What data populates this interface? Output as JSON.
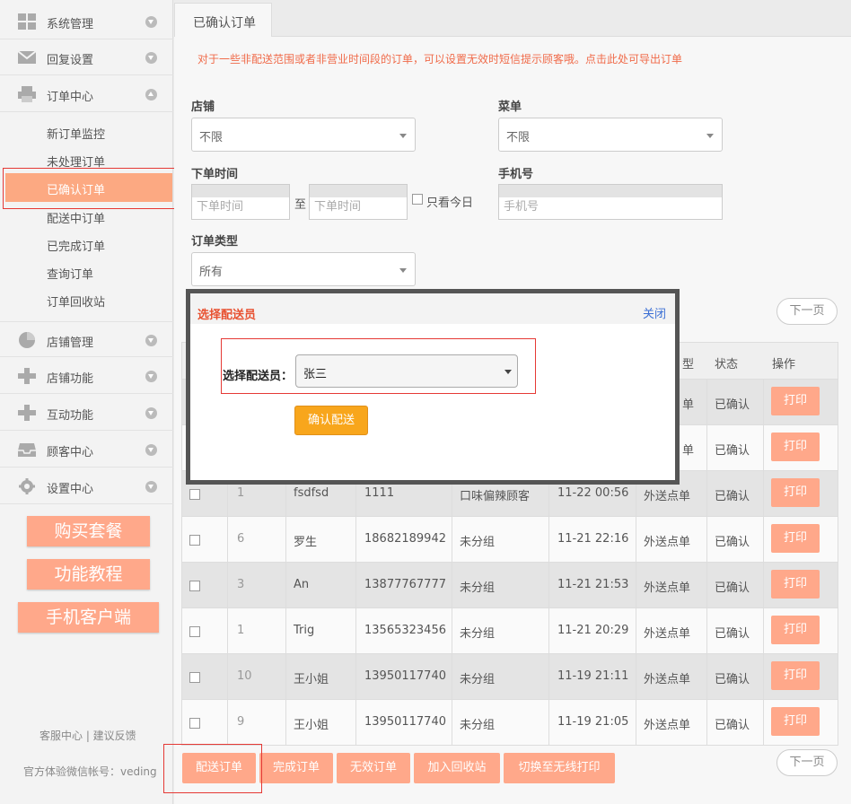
{
  "sidebar": {
    "items": [
      {
        "label": "系统管理",
        "icon": "grid-icon"
      },
      {
        "label": "回复设置",
        "icon": "envelope-icon"
      },
      {
        "label": "订单中心",
        "icon": "printer-icon"
      }
    ],
    "order_sub": [
      "新订单监控",
      "未处理订单",
      "已确认订单",
      "配送中订单",
      "已完成订单",
      "查询订单",
      "订单回收站"
    ],
    "items2": [
      {
        "label": "店铺管理",
        "icon": "pie-chart-icon"
      },
      {
        "label": "店铺功能",
        "icon": "plus-icon"
      },
      {
        "label": "互动功能",
        "icon": "plus-icon"
      },
      {
        "label": "顾客中心",
        "icon": "inbox-icon"
      },
      {
        "label": "设置中心",
        "icon": "gear-icon"
      }
    ],
    "promos": [
      "购买套餐",
      "功能教程",
      "手机客户端"
    ],
    "footer_links": "客服中心 | 建议反馈",
    "footer_account": "官方体验微信帐号：veding"
  },
  "tab": "已确认订单",
  "notice": "对于一些非配送范围或者非营业时间段的订单，可以设置无效时短信提示顾客哦。点击此处可导出订单",
  "filters": {
    "store_label": "店铺",
    "store_value": "不限",
    "menu_label": "菜单",
    "menu_value": "不限",
    "time_label": "下单时间",
    "time_from_ph": "下单时间",
    "time_to": "至",
    "time_to_ph": "下单时间",
    "today_label": "只看今日",
    "phone_label": "手机号",
    "phone_ph": "手机号",
    "type_label": "订单类型",
    "type_value": "所有"
  },
  "pager_next": "下一页",
  "table": {
    "headers": {
      "type_partial": "型",
      "status": "状态",
      "op": "操作"
    },
    "print_label": "打印",
    "rows": [
      {
        "num": "",
        "name": "",
        "phone": "",
        "group": "",
        "time": "",
        "type": "单",
        "status": "已确认"
      },
      {
        "num": "",
        "name": "",
        "phone": "",
        "group": "",
        "time": "",
        "type": "单",
        "status": "已确认"
      },
      {
        "num": "1",
        "name": "fsdfsd",
        "phone": "1111",
        "group": "口味偏辣顾客",
        "time": "11-22 00:56",
        "type": "外送点单",
        "status": "已确认"
      },
      {
        "num": "6",
        "name": "罗生",
        "phone": "18682189942",
        "group": "未分组",
        "time": "11-21 22:16",
        "type": "外送点单",
        "status": "已确认"
      },
      {
        "num": "3",
        "name": "An",
        "phone": "13877767777",
        "group": "未分组",
        "time": "11-21 21:53",
        "type": "外送点单",
        "status": "已确认"
      },
      {
        "num": "1",
        "name": "Trig",
        "phone": "13565323456",
        "group": "未分组",
        "time": "11-21 20:29",
        "type": "外送点单",
        "status": "已确认"
      },
      {
        "num": "10",
        "name": "王小姐",
        "phone": "13950117740",
        "group": "未分组",
        "time": "11-19 21:11",
        "type": "外送点单",
        "status": "已确认"
      },
      {
        "num": "9",
        "name": "王小姐",
        "phone": "13950117740",
        "group": "未分组",
        "time": "11-19 21:05",
        "type": "外送点单",
        "status": "已确认"
      }
    ]
  },
  "actions": [
    "配送订单",
    "完成订单",
    "无效订单",
    "加入回收站",
    "切换至无线打印"
  ],
  "modal": {
    "title": "选择配送员",
    "close": "关闭",
    "select_label": "选择配送员：",
    "select_value": "张三",
    "confirm": "确认配送"
  }
}
